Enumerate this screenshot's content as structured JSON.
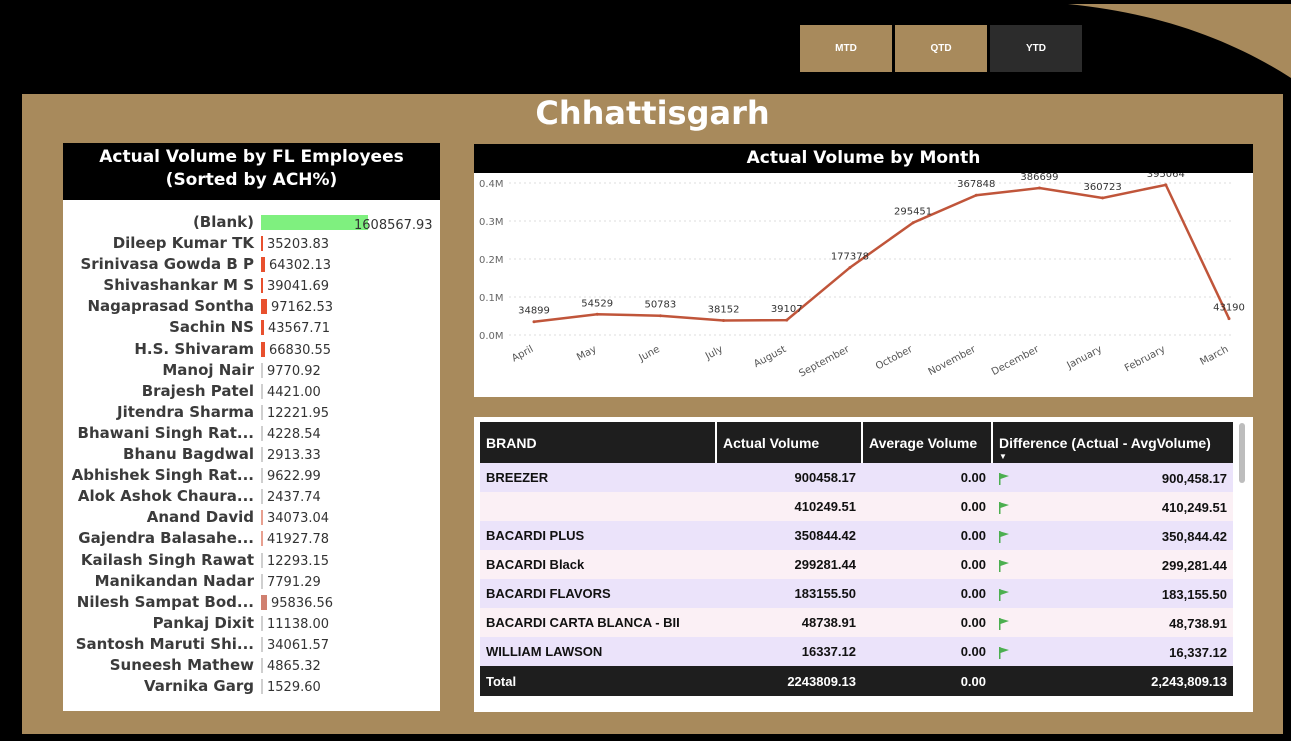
{
  "period_buttons": {
    "mtd": "MTD",
    "qtd": "QTD",
    "ytd": "YTD"
  },
  "region_title": "Chhattisgarh",
  "employees": {
    "title_line1": "Actual Volume by FL Employees",
    "title_line2": "(Sorted by ACH%)",
    "rows": [
      {
        "name": "(Blank)",
        "value": "1608567.93",
        "bar_color": "#7ff07f",
        "bar_fraction": 1.0
      },
      {
        "name": "Dileep Kumar TK",
        "value": "35203.83",
        "bar_color": "#e8502e",
        "bar_fraction": 0.02
      },
      {
        "name": "Srinivasa Gowda B P",
        "value": "64302.13",
        "bar_color": "#e8502e",
        "bar_fraction": 0.035
      },
      {
        "name": "Shivashankar M S",
        "value": "39041.69",
        "bar_color": "#e8502e",
        "bar_fraction": 0.022
      },
      {
        "name": "Nagaprasad Sontha",
        "value": "97162.53",
        "bar_color": "#e8502e",
        "bar_fraction": 0.055
      },
      {
        "name": "Sachin NS",
        "value": "43567.71",
        "bar_color": "#e8502e",
        "bar_fraction": 0.025
      },
      {
        "name": "H.S. Shivaram",
        "value": "66830.55",
        "bar_color": "#e8502e",
        "bar_fraction": 0.037
      },
      {
        "name": "Manoj Nair",
        "value": "9770.92",
        "bar_color": "#cfcfcf",
        "bar_fraction": 0.008
      },
      {
        "name": "Brajesh Patel",
        "value": "4421.00",
        "bar_color": "#cfcfcf",
        "bar_fraction": 0.008
      },
      {
        "name": "Jitendra Sharma",
        "value": "12221.95",
        "bar_color": "#cfcfcf",
        "bar_fraction": 0.008
      },
      {
        "name": "Bhawani Singh Rat...",
        "value": "4228.54",
        "bar_color": "#cfcfcf",
        "bar_fraction": 0.008
      },
      {
        "name": "Bhanu Bagdwal",
        "value": "2913.33",
        "bar_color": "#cfcfcf",
        "bar_fraction": 0.008
      },
      {
        "name": "Abhishek Singh Rat...",
        "value": "9622.99",
        "bar_color": "#cfcfcf",
        "bar_fraction": 0.008
      },
      {
        "name": "Alok Ashok Chaura...",
        "value": "2437.74",
        "bar_color": "#cfcfcf",
        "bar_fraction": 0.008
      },
      {
        "name": "Anand David",
        "value": "34073.04",
        "bar_color": "#e8a090",
        "bar_fraction": 0.012
      },
      {
        "name": "Gajendra Balasahe...",
        "value": "41927.78",
        "bar_color": "#e8a090",
        "bar_fraction": 0.012
      },
      {
        "name": "Kailash Singh Rawat",
        "value": "12293.15",
        "bar_color": "#cfcfcf",
        "bar_fraction": 0.008
      },
      {
        "name": "Manikandan Nadar",
        "value": "7791.29",
        "bar_color": "#cfcfcf",
        "bar_fraction": 0.008
      },
      {
        "name": "Nilesh Sampat Bod...",
        "value": "95836.56",
        "bar_color": "#d08070",
        "bar_fraction": 0.06
      },
      {
        "name": "Pankaj Dixit",
        "value": "11138.00",
        "bar_color": "#cfcfcf",
        "bar_fraction": 0.008
      },
      {
        "name": "Santosh Maruti Shi...",
        "value": "34061.57",
        "bar_color": "#cfcfcf",
        "bar_fraction": 0.008
      },
      {
        "name": "Suneesh Mathew",
        "value": "4865.32",
        "bar_color": "#cfcfcf",
        "bar_fraction": 0.008
      },
      {
        "name": "Varnika Garg",
        "value": "1529.60",
        "bar_color": "#cfcfcf",
        "bar_fraction": 0.008
      }
    ]
  },
  "chart_data": {
    "type": "line",
    "title": "Actual Volume by Month",
    "categories": [
      "April",
      "May",
      "June",
      "July",
      "August",
      "September",
      "October",
      "November",
      "December",
      "January",
      "February",
      "March"
    ],
    "series": [
      {
        "values": [
          34899,
          54529,
          50783,
          38152,
          39107,
          177378,
          295451,
          367848,
          386699,
          360723,
          395064,
          43190
        ],
        "labels": [
          "34899",
          "54529",
          "50783",
          "38152",
          "39107",
          "177378",
          "295451",
          "367848",
          "386699",
          "360723",
          "395064",
          "43190"
        ]
      }
    ],
    "yticks": [
      "0.0M",
      "0.1M",
      "0.2M",
      "0.3M",
      "0.4M"
    ],
    "ylim": [
      0,
      400000
    ],
    "line_color": "#c0553a",
    "grid": true
  },
  "brand_table": {
    "columns": [
      "BRAND",
      "Actual Volume",
      "Average Volume",
      "Difference (Actual - AvgVolume)"
    ],
    "rows": [
      {
        "brand": "BREEZER",
        "actual": "900458.17",
        "average": "0.00",
        "diff": "900,458.17"
      },
      {
        "brand": "",
        "actual": "410249.51",
        "average": "0.00",
        "diff": "410,249.51"
      },
      {
        "brand": "BACARDI PLUS",
        "actual": "350844.42",
        "average": "0.00",
        "diff": "350,844.42"
      },
      {
        "brand": "BACARDI Black",
        "actual": "299281.44",
        "average": "0.00",
        "diff": "299,281.44"
      },
      {
        "brand": "BACARDI FLAVORS",
        "actual": "183155.50",
        "average": "0.00",
        "diff": "183,155.50"
      },
      {
        "brand": "BACARDI CARTA BLANCA - BII",
        "actual": "48738.91",
        "average": "0.00",
        "diff": "48,738.91"
      },
      {
        "brand": "WILLIAM LAWSON",
        "actual": "16337.12",
        "average": "0.00",
        "diff": "16,337.12"
      }
    ],
    "total": {
      "label": "Total",
      "actual": "2243809.13",
      "average": "0.00",
      "diff": "2,243,809.13"
    },
    "flag_color": "#4caf50"
  }
}
